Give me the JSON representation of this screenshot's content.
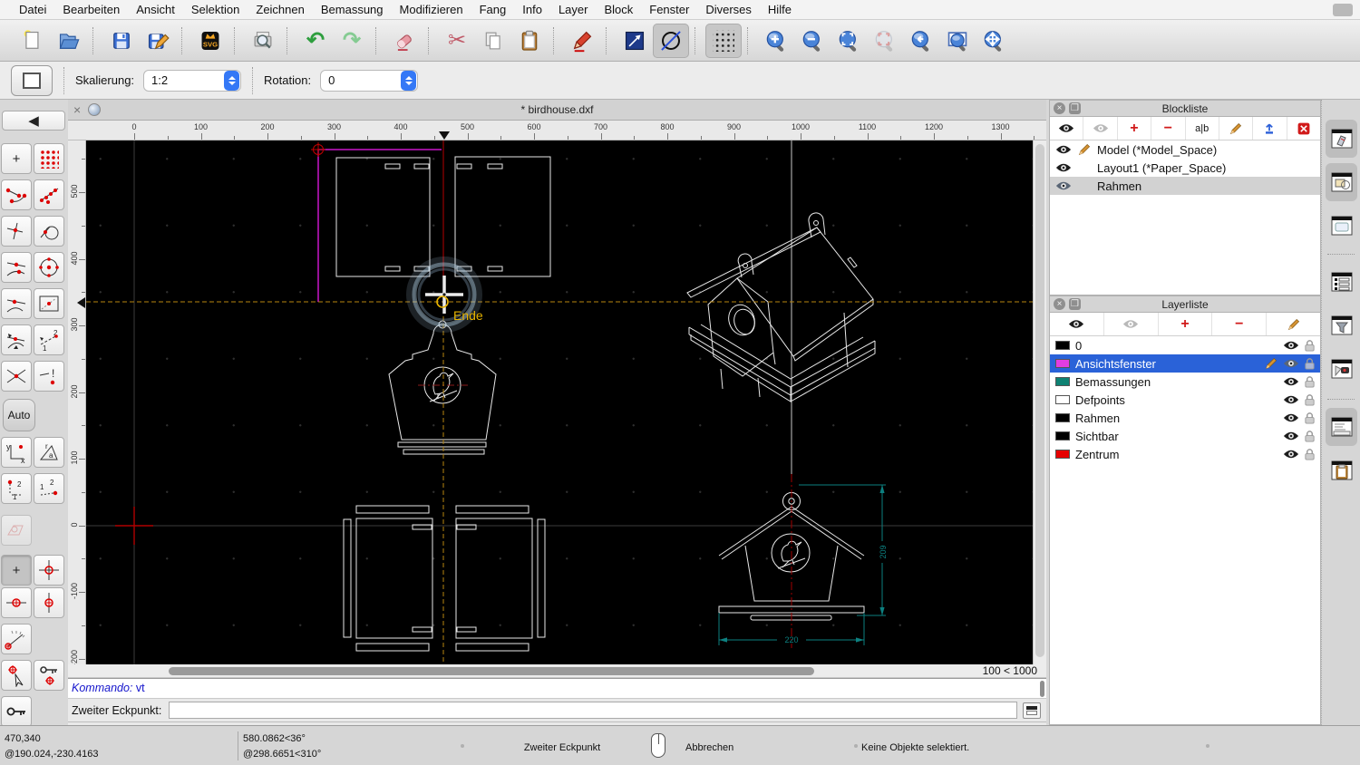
{
  "menubar": {
    "items": [
      "Datei",
      "Bearbeiten",
      "Ansicht",
      "Selektion",
      "Zeichnen",
      "Bemassung",
      "Modifizieren",
      "Fang",
      "Info",
      "Layer",
      "Block",
      "Fenster",
      "Diverses",
      "Hilfe"
    ]
  },
  "toolbar": {
    "icons": [
      "new-file",
      "open-file",
      "save",
      "save-as",
      "svg-export",
      "print-preview",
      "undo",
      "redo",
      "delete",
      "cut",
      "copy",
      "paste",
      "drawing-preferences",
      "line-tool",
      "ellipse-tool",
      "grid-toggle",
      "zoom-in",
      "zoom-out",
      "auto-zoom",
      "zoom-selection",
      "previous-view",
      "zoom-window",
      "pan"
    ],
    "glyphs": {
      "undo": "↶",
      "redo": "↷",
      "cut": "✂",
      "svg": "SVG"
    }
  },
  "options": {
    "scale_label": "Skalierung:",
    "scale_value": "1:2",
    "rotation_label": "Rotation:",
    "rotation_value": "0"
  },
  "document": {
    "tab_title": "* birdhouse.dxf",
    "close_glyph": "×",
    "zoom_status": "100 < 1000"
  },
  "rulers": {
    "horizontal": [
      "0",
      "100",
      "200",
      "300",
      "400",
      "500",
      "600",
      "700",
      "800",
      "900",
      "1000",
      "1100",
      "1200",
      "1300"
    ],
    "vertical": [
      "500",
      "400",
      "300",
      "200",
      "100",
      "0",
      "-100",
      "-200"
    ]
  },
  "canvas": {
    "snap_label": "Ende",
    "dim_width": "220",
    "dim_height": "209"
  },
  "command": {
    "history_label": "Kommando:",
    "history_value": "vt",
    "prompt_label": "Zweiter Eckpunkt:"
  },
  "statusbar": {
    "abs_coord": "470,340",
    "rel_coord": "@190.024,-230.4163",
    "abs_polar": "580.0862<36°",
    "rel_polar": "@298.6651<310°",
    "mouse_left_hint": "Zweiter Eckpunkt",
    "mouse_right_hint": "Abbrechen",
    "selection_info": "Keine Objekte selektiert."
  },
  "blockliste": {
    "title": "Blockliste",
    "toolbar_glyphs": {
      "add": "+",
      "remove": "−",
      "rename": "a|b"
    },
    "items": [
      {
        "label": "Model (*Model_Space)",
        "editing": true,
        "selected": false
      },
      {
        "label": "Layout1 (*Paper_Space)",
        "editing": false,
        "selected": false
      },
      {
        "label": "Rahmen",
        "editing": false,
        "selected": true
      }
    ]
  },
  "layerliste": {
    "title": "Layerliste",
    "toolbar_glyphs": {
      "add": "+",
      "remove": "−"
    },
    "items": [
      {
        "name": "0",
        "color": "#000000",
        "selected": false,
        "editing": false
      },
      {
        "name": "Ansichtsfenster",
        "color": "#e23de2",
        "selected": true,
        "editing": true
      },
      {
        "name": "Bemassungen",
        "color": "#0e8273",
        "selected": false,
        "editing": false
      },
      {
        "name": "Defpoints",
        "color": "#ffffff",
        "selected": false,
        "editing": false
      },
      {
        "name": "Rahmen",
        "color": "#000000",
        "selected": false,
        "editing": false
      },
      {
        "name": "Sichtbar",
        "color": "#000000",
        "selected": false,
        "editing": false
      },
      {
        "name": "Zentrum",
        "color": "#e60000",
        "selected": false,
        "editing": false
      }
    ]
  },
  "palette": {
    "auto_label": "Auto"
  },
  "colors": {
    "selection_blue": "#2a62d8",
    "viewport_magenta": "#c816c8",
    "crosshair_orange": "#b8860f",
    "snap_yellow": "#e8b400",
    "dimension_teal": "#0d8080",
    "centerline_red": "#a00000",
    "drawing_white": "#e8e8e8",
    "canvas_black": "#000000"
  }
}
